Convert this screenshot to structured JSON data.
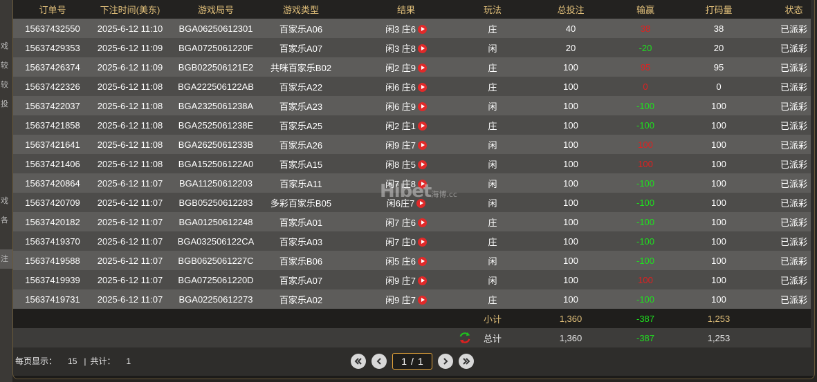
{
  "bg_fragments": [
    "",
    "戏",
    "较",
    "较",
    "投",
    "",
    "",
    "",
    "",
    "戏",
    "各",
    "",
    "注",
    "",
    "",
    "",
    "",
    "",
    ""
  ],
  "columns": [
    "订单号",
    "下注时间(美东)",
    "游戏局号",
    "游戏类型",
    "结果",
    "玩法",
    "总投注",
    "输赢",
    "打码量",
    "状态"
  ],
  "rows": [
    {
      "order": "15637432550",
      "time": "2025-6-12 11:10",
      "round": "BGA06250612301",
      "game": "百家乐A06",
      "result": "闲3 庄6",
      "play": "庄",
      "bet": "40",
      "win": "38",
      "win_color": "red",
      "valid": "38",
      "status": "已派彩"
    },
    {
      "order": "15637429353",
      "time": "2025-6-12 11:09",
      "round": "BGA0725061220F",
      "game": "百家乐A07",
      "result": "闲3 庄8",
      "play": "闲",
      "bet": "20",
      "win": "-20",
      "win_color": "green",
      "valid": "20",
      "status": "已派彩"
    },
    {
      "order": "15637426374",
      "time": "2025-6-12 11:09",
      "round": "BGB022506121E2",
      "game": "共咪百家乐B02",
      "result": "闲2 庄9",
      "play": "庄",
      "bet": "100",
      "win": "95",
      "win_color": "red",
      "valid": "95",
      "status": "已派彩"
    },
    {
      "order": "15637422326",
      "time": "2025-6-12 11:08",
      "round": "BGA222506122AB",
      "game": "百家乐A22",
      "result": "闲6 庄6",
      "play": "庄",
      "bet": "100",
      "win": "0",
      "win_color": "red",
      "valid": "0",
      "status": "已派彩"
    },
    {
      "order": "15637422037",
      "time": "2025-6-12 11:08",
      "round": "BGA2325061238A",
      "game": "百家乐A23",
      "result": "闲6 庄9",
      "play": "闲",
      "bet": "100",
      "win": "-100",
      "win_color": "green",
      "valid": "100",
      "status": "已派彩"
    },
    {
      "order": "15637421858",
      "time": "2025-6-12 11:08",
      "round": "BGA2525061238E",
      "game": "百家乐A25",
      "result": "闲2 庄1",
      "play": "庄",
      "bet": "100",
      "win": "-100",
      "win_color": "green",
      "valid": "100",
      "status": "已派彩"
    },
    {
      "order": "15637421641",
      "time": "2025-6-12 11:08",
      "round": "BGA2625061233B",
      "game": "百家乐A26",
      "result": "闲9 庄7",
      "play": "闲",
      "bet": "100",
      "win": "100",
      "win_color": "red",
      "valid": "100",
      "status": "已派彩"
    },
    {
      "order": "15637421406",
      "time": "2025-6-12 11:08",
      "round": "BGA152506122A0",
      "game": "百家乐A15",
      "result": "闲8 庄5",
      "play": "闲",
      "bet": "100",
      "win": "100",
      "win_color": "red",
      "valid": "100",
      "status": "已派彩"
    },
    {
      "order": "15637420864",
      "time": "2025-6-12 11:07",
      "round": "BGA11250612203",
      "game": "百家乐A11",
      "result": "闲7 庄8",
      "play": "闲",
      "bet": "100",
      "win": "-100",
      "win_color": "green",
      "valid": "100",
      "status": "已派彩"
    },
    {
      "order": "15637420709",
      "time": "2025-6-12 11:07",
      "round": "BGB05250612283",
      "game": "多彩百家乐B05",
      "result": "闲6庄7",
      "play": "闲",
      "bet": "100",
      "win": "-100",
      "win_color": "green",
      "valid": "100",
      "status": "已派彩"
    },
    {
      "order": "15637420182",
      "time": "2025-6-12 11:07",
      "round": "BGA01250612248",
      "game": "百家乐A01",
      "result": "闲7 庄6",
      "play": "庄",
      "bet": "100",
      "win": "-100",
      "win_color": "green",
      "valid": "100",
      "status": "已派彩"
    },
    {
      "order": "15637419370",
      "time": "2025-6-12 11:07",
      "round": "BGA032506122CA",
      "game": "百家乐A03",
      "result": "闲7 庄0",
      "play": "庄",
      "bet": "100",
      "win": "-100",
      "win_color": "green",
      "valid": "100",
      "status": "已派彩"
    },
    {
      "order": "15637419588",
      "time": "2025-6-12 11:07",
      "round": "BGB0625061227C",
      "game": "百家乐B06",
      "result": "闲5 庄6",
      "play": "闲",
      "bet": "100",
      "win": "-100",
      "win_color": "green",
      "valid": "100",
      "status": "已派彩"
    },
    {
      "order": "15637419939",
      "time": "2025-6-12 11:07",
      "round": "BGA0725061220D",
      "game": "百家乐A07",
      "result": "闲9 庄7",
      "play": "闲",
      "bet": "100",
      "win": "100",
      "win_color": "red",
      "valid": "100",
      "status": "已派彩"
    },
    {
      "order": "15637419731",
      "time": "2025-6-12 11:07",
      "round": "BGA02250612273",
      "game": "百家乐A02",
      "result": "闲9 庄7",
      "play": "庄",
      "bet": "100",
      "win": "-100",
      "win_color": "green",
      "valid": "100",
      "status": "已派彩"
    }
  ],
  "subtotal": {
    "label": "小计",
    "bet": "1,360",
    "win": "-387",
    "valid": "1,253"
  },
  "total": {
    "label": "总计",
    "bet": "1,360",
    "win": "-387",
    "valid": "1,253"
  },
  "footer": {
    "per_page_label": "每页显示：",
    "per_page_value": "15",
    "separator": "|",
    "total_label": "共计：",
    "total_value": "1"
  },
  "pager": {
    "current": "1",
    "slash": "/",
    "pages": "1"
  },
  "watermark": {
    "text": "Hibet",
    "sub_cn": "海博",
    "sub_en": ".cc"
  },
  "colors": {
    "header_text": "#e2c07a",
    "loss_red": "#e02020",
    "win_green": "#1fe01f",
    "page_box_border": "#e2a23a"
  },
  "icons": {
    "result_video": "play-circle-icon",
    "refresh": "refresh-icon",
    "first": "double-chevron-left-icon",
    "prev": "chevron-left-icon",
    "next": "chevron-right-icon",
    "last": "double-chevron-right-icon"
  }
}
